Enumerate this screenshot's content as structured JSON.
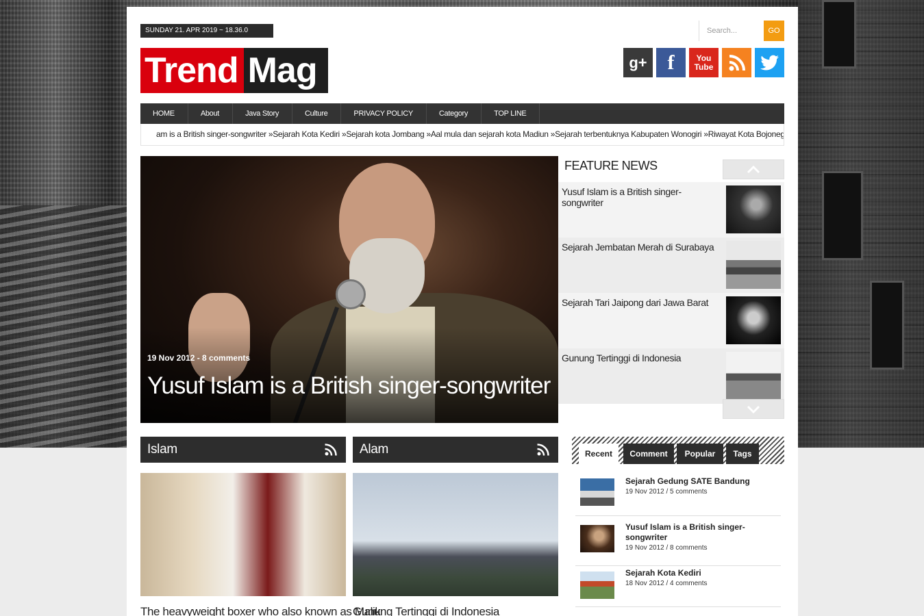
{
  "header": {
    "date": "SUNDAY 21. APR 2019 ~ 18.36.0",
    "search_placeholder": "Search...",
    "go_label": "GO",
    "logo_part1": "Trend",
    "logo_part2": "Mag",
    "social": [
      "g+",
      "f",
      "You Tube",
      "rss-icon",
      "twitter-icon"
    ]
  },
  "nav": {
    "items": [
      "HOME",
      "About",
      "Java Story",
      "Culture",
      "PRIVACY POLICY",
      "Category",
      "TOP LINE"
    ]
  },
  "ticker": "am is a British singer-songwriter »Sejarah Kota Kediri »Sejarah kota Jombang »Aal mula dan sejarah kota Madiun »Sejarah terbentuknya Kabupaten Wonogiri »Riwayat Kota Bojonegoro »Asal mu",
  "hero": {
    "meta": "19 Nov 2012 - 8 comments",
    "title": "Yusuf Islam is a British singer-songwriter"
  },
  "feature_news": {
    "heading": "FEATURE NEWS",
    "items": [
      {
        "title": "Yusuf Islam is a British singer-songwriter"
      },
      {
        "title": "Sejarah Jembatan Merah di Surabaya"
      },
      {
        "title": "Sejarah Tari Jaipong dari Jawa Barat"
      },
      {
        "title": "Gunung Tertinggi di Indonesia"
      }
    ]
  },
  "categories": [
    {
      "name": "Islam",
      "post_title": "The heavyweight boxer who also known as Malik"
    },
    {
      "name": "Alam",
      "post_title": "Gunung Tertinggi di Indonesia"
    }
  ],
  "tabs": {
    "items": [
      "Recent",
      "Comment",
      "Popular",
      "Tags"
    ],
    "active": "Recent",
    "recent": [
      {
        "title": "Sejarah Gedung SATE Bandung",
        "meta": "19 Nov 2012 / 5 comments"
      },
      {
        "title": "Yusuf Islam is a British singer-songwriter",
        "meta": "19 Nov 2012 / 8 comments"
      },
      {
        "title": "Sejarah Kota Kediri",
        "meta": "18 Nov 2012 / 4 comments"
      }
    ]
  },
  "colors": {
    "accent_red": "#d9000d",
    "go_orange": "#f39c12",
    "nav_dark": "#333333"
  }
}
